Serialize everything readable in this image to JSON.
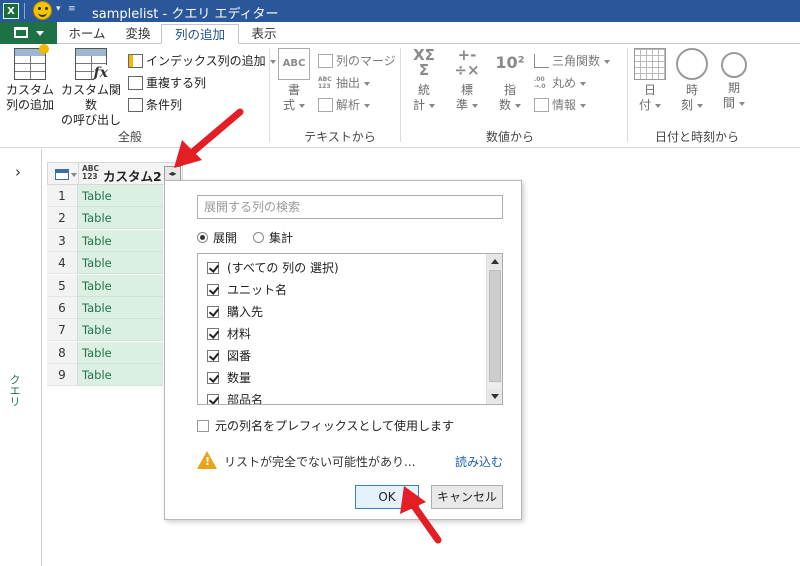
{
  "window": {
    "app_icon_label": "X",
    "title": "samplelist - クエリ エディター"
  },
  "ribbon_tabs": {
    "items": [
      "ホーム",
      "変換",
      "列の追加",
      "表示"
    ],
    "active": "列の追加"
  },
  "ribbon": {
    "general": {
      "label": "全般",
      "custom_column": [
        "カスタム",
        "列の追加"
      ],
      "invoke_custom_function": [
        "カスタム関数",
        "の呼び出し"
      ],
      "add_index_column": "インデックス列の追加",
      "duplicate_column": "重複する列",
      "conditional_column": "条件列"
    },
    "text": {
      "label": "テキストから",
      "format": [
        "書",
        "式"
      ],
      "merge_columns": "列のマージ",
      "extract": "抽出",
      "parse": "解析"
    },
    "number": {
      "label": "数値から",
      "statistics": [
        "統",
        "計"
      ],
      "standard": [
        "標",
        "準"
      ],
      "scientific": [
        "指",
        "数"
      ],
      "trigonometry": "三角関数",
      "rounding": "丸め",
      "information": "情報"
    },
    "datetime": {
      "label": "日付と時刻から",
      "date": [
        "日",
        "付"
      ],
      "time": [
        "時",
        "刻"
      ],
      "duration": [
        "期",
        "間"
      ]
    }
  },
  "query_pane": {
    "label": "クエリ"
  },
  "table": {
    "type_label_top": "ABC",
    "type_label_bottom": "123",
    "column_header": "カスタム2",
    "rows": [
      {
        "num": "1",
        "value": "Table"
      },
      {
        "num": "2",
        "value": "Table"
      },
      {
        "num": "3",
        "value": "Table"
      },
      {
        "num": "4",
        "value": "Table"
      },
      {
        "num": "5",
        "value": "Table"
      },
      {
        "num": "6",
        "value": "Table"
      },
      {
        "num": "7",
        "value": "Table"
      },
      {
        "num": "8",
        "value": "Table"
      },
      {
        "num": "9",
        "value": "Table"
      }
    ]
  },
  "expand_popup": {
    "search_placeholder": "展開する列の検索",
    "radio_expand": "展開",
    "radio_aggregate": "集計",
    "selected_mode": "展開",
    "columns": [
      {
        "label": "(すべての 列の 選択)",
        "checked": true
      },
      {
        "label": "ユニット名",
        "checked": true
      },
      {
        "label": "購入先",
        "checked": true
      },
      {
        "label": "材料",
        "checked": true
      },
      {
        "label": "図番",
        "checked": true
      },
      {
        "label": "数量",
        "checked": true
      },
      {
        "label": "部品名",
        "checked": true
      }
    ],
    "prefix_option": "元の列名をプレフィックスとして使用します",
    "prefix_checked": false,
    "warning": "リストが完全でない可能性があり...",
    "load_more": "読み込む",
    "ok_label": "OK",
    "cancel_label": "キャンセル"
  },
  "colors": {
    "title_bar": "#2a579a",
    "file_tab": "#1e7145",
    "cell_fill": "#dcefe3",
    "cell_text": "#217346",
    "annotation_arrow": "#e31e24"
  }
}
